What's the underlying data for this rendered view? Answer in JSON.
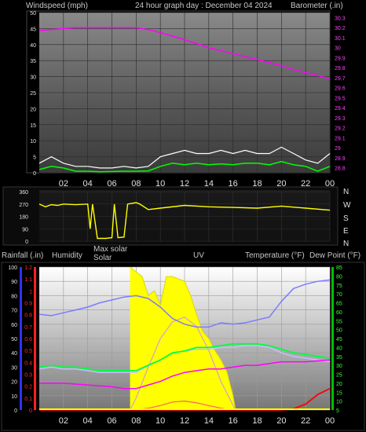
{
  "header": {
    "windspeed_label": "Windspeed (mph)",
    "graph_title": "24 hour graph day : December 04 2024",
    "barometer_label": "Barometer (.in)"
  },
  "bottom_header": {
    "rainfall_label": "Rainfall (.in)",
    "humidity_label": "Humidity",
    "max_solar_label": "Max solar",
    "solar_label": "Solar",
    "uv_label": "UV",
    "temperature_label": "Temperature (°F)",
    "dew_point_label": "Dew Point (°F)"
  },
  "direction_labels": [
    "N",
    "W",
    "S",
    "E",
    "N"
  ],
  "colors": {
    "windspeed": "#ffffff",
    "gust_avg": "#00ff00",
    "barometer": "#ff00ff",
    "wind_direction": "#ffff00",
    "humidity": "#7b7bff",
    "temperature": "#00ff40",
    "dew_point": "#ff00ff",
    "rainfall": "#ff0000",
    "solar": "#ffff00",
    "max_solar": "#d0a0d0",
    "uv": "#ff6060",
    "apparent": "#c0c0ff"
  },
  "chart_data": [
    {
      "type": "line",
      "name": "wind_and_barometer",
      "x_tick_labels": [
        "02",
        "04",
        "06",
        "08",
        "10",
        "12",
        "14",
        "16",
        "18",
        "20",
        "22",
        "00"
      ],
      "y_left_ticks": [
        "0",
        "5",
        "10",
        "15",
        "20",
        "25",
        "30",
        "35",
        "40",
        "45",
        "50"
      ],
      "y_left_range": [
        0,
        50
      ],
      "y_right_ticks": [
        "28.8",
        "28.9",
        "29",
        "29.1",
        "29.2",
        "29.3",
        "29.4",
        "29.5",
        "29.6",
        "29.7",
        "29.8",
        "29.9",
        "30",
        "30.1",
        "30.2",
        "30.3"
      ],
      "y_right_range": [
        28.75,
        30.35
      ],
      "series": [
        {
          "key": "barometer",
          "x": [
            0,
            3,
            6,
            8,
            9,
            10,
            12,
            14,
            16,
            18,
            20,
            21,
            22,
            23,
            24
          ],
          "y": [
            30.17,
            30.2,
            30.2,
            30.2,
            30.18,
            30.15,
            30.08,
            30.0,
            29.94,
            29.88,
            29.82,
            29.78,
            29.75,
            29.72,
            29.69
          ]
        },
        {
          "key": "gust_avg",
          "x": [
            0,
            1,
            2,
            3,
            4,
            5,
            6,
            7,
            8,
            9,
            10,
            11,
            12,
            13,
            14,
            15,
            16,
            17,
            18,
            19,
            20,
            21,
            22,
            23,
            24
          ],
          "y": [
            1,
            2,
            1.5,
            0.5,
            0.5,
            0.3,
            0.4,
            0.5,
            0.5,
            0.6,
            2,
            3,
            2.5,
            3,
            2.5,
            2.8,
            2.5,
            3,
            3,
            2.5,
            3.5,
            2.5,
            2,
            0.5,
            2
          ]
        },
        {
          "key": "windspeed",
          "x": [
            0,
            1,
            2,
            3,
            4,
            5,
            6,
            7,
            8,
            9,
            10,
            11,
            12,
            13,
            14,
            15,
            16,
            17,
            18,
            19,
            20,
            21,
            22,
            23,
            24
          ],
          "y": [
            3,
            5,
            3,
            2,
            2,
            1.5,
            1.5,
            2,
            1.5,
            2,
            5,
            6,
            7,
            6,
            6,
            7,
            6,
            7,
            6,
            6,
            8,
            6,
            4,
            3,
            6
          ]
        }
      ]
    },
    {
      "type": "line",
      "name": "wind_direction",
      "y_left_ticks": [
        "0",
        "90",
        "180",
        "270",
        "360"
      ],
      "y_range": [
        0,
        360
      ],
      "series": [
        {
          "key": "wind_direction",
          "x": [
            0,
            0.5,
            1,
            1.5,
            2,
            3,
            4,
            4.2,
            4.4,
            4.8,
            5,
            5.5,
            6,
            6.2,
            6.5,
            7,
            7.3,
            8,
            8.3,
            9,
            10,
            12,
            14,
            16,
            18,
            20,
            22,
            24
          ],
          "y": [
            270,
            250,
            265,
            260,
            270,
            265,
            270,
            90,
            270,
            20,
            20,
            20,
            25,
            270,
            25,
            30,
            270,
            280,
            270,
            230,
            240,
            260,
            250,
            245,
            240,
            255,
            240,
            225
          ]
        }
      ]
    },
    {
      "type": "line",
      "name": "humidity_solar_temperature",
      "y_humidity_ticks": [
        "0",
        "10",
        "20",
        "30",
        "40",
        "50",
        "60",
        "70",
        "80",
        "90",
        "100"
      ],
      "y_humidity_range": [
        0,
        100
      ],
      "y_rain_ticks": [
        "0",
        "0.1",
        "0.2",
        "0.3",
        "0.4",
        "0.5",
        "0.6",
        "0.7",
        "0.8",
        "0.9",
        "1",
        "1.1",
        "1.2"
      ],
      "y_rain_range": [
        0,
        1.2
      ],
      "y_temp_ticks": [
        "5",
        "10",
        "15",
        "20",
        "25",
        "30",
        "35",
        "40",
        "45",
        "50",
        "55",
        "60",
        "65",
        "70",
        "75",
        "80",
        "85"
      ],
      "y_temp_range": [
        5,
        85
      ],
      "series": [
        {
          "key": "humidity",
          "x": [
            0,
            1,
            2,
            3,
            4,
            5,
            6,
            7,
            8,
            9,
            10,
            11,
            12,
            13,
            14,
            15,
            16,
            17,
            18,
            19,
            20,
            21,
            22,
            23,
            24
          ],
          "y": [
            67,
            66,
            68,
            70,
            72,
            75,
            77,
            79,
            80,
            78,
            72,
            64,
            60,
            58,
            58,
            61,
            60,
            61,
            63,
            65,
            76,
            85,
            88,
            90,
            91
          ]
        },
        {
          "key": "temperature",
          "x": [
            0,
            1,
            2,
            3,
            4,
            5,
            6,
            7,
            8,
            9,
            10,
            11,
            12,
            13,
            14,
            15,
            16,
            17,
            18,
            19,
            20,
            21,
            22,
            23,
            24
          ],
          "y": [
            29,
            30,
            29,
            29,
            28,
            27,
            27,
            27,
            27,
            30,
            33,
            37,
            38,
            40,
            40,
            41,
            42,
            42,
            42,
            41,
            39,
            37,
            36,
            35,
            34
          ]
        },
        {
          "key": "apparent",
          "x": [
            0,
            1,
            2,
            3,
            4,
            5,
            6,
            7,
            8,
            9,
            10,
            11,
            12,
            13,
            14,
            15,
            16,
            17,
            18,
            19,
            20,
            21,
            22,
            23,
            24
          ],
          "y": [
            28,
            29,
            28,
            28,
            27,
            26,
            26,
            26,
            26,
            30,
            33,
            37,
            38,
            39,
            39,
            40,
            40,
            41,
            41,
            40,
            37,
            35,
            34,
            33,
            32
          ]
        },
        {
          "key": "dew_point",
          "x": [
            0,
            2,
            4,
            6,
            7,
            8,
            9,
            10,
            11,
            12,
            13,
            14,
            15,
            16,
            17,
            18,
            19,
            20,
            22,
            24
          ],
          "y": [
            20,
            20,
            19,
            18,
            17,
            17,
            19,
            21,
            24,
            26,
            27,
            28,
            28,
            29,
            30,
            30,
            31,
            32,
            32,
            33
          ]
        },
        {
          "key": "rainfall",
          "x": [
            0,
            20,
            21,
            22,
            23,
            24
          ],
          "y": [
            0,
            0,
            0.01,
            0.05,
            0.13,
            0.18
          ]
        },
        {
          "key": "max_solar",
          "x": [
            7.5,
            8,
            9,
            10,
            11,
            12,
            13,
            14,
            15,
            16.2
          ],
          "y": [
            0,
            50,
            180,
            300,
            370,
            390,
            350,
            250,
            120,
            0
          ]
        },
        {
          "key": "solar",
          "x": [
            7.5,
            8,
            8.5,
            9,
            9.5,
            10,
            10.5,
            11,
            11.5,
            12,
            12.5,
            13,
            13.5,
            14,
            14.5,
            15,
            15.5,
            16,
            16.2
          ],
          "y": [
            600,
            580,
            560,
            480,
            500,
            440,
            560,
            560,
            550,
            540,
            480,
            400,
            330,
            300,
            250,
            210,
            160,
            60,
            0
          ]
        },
        {
          "key": "uv",
          "x": [
            7.5,
            9,
            10,
            11,
            12,
            13,
            14,
            15,
            16
          ],
          "y": [
            0,
            0.2,
            0.5,
            0.9,
            1.0,
            0.8,
            0.5,
            0.2,
            0
          ]
        }
      ]
    }
  ]
}
